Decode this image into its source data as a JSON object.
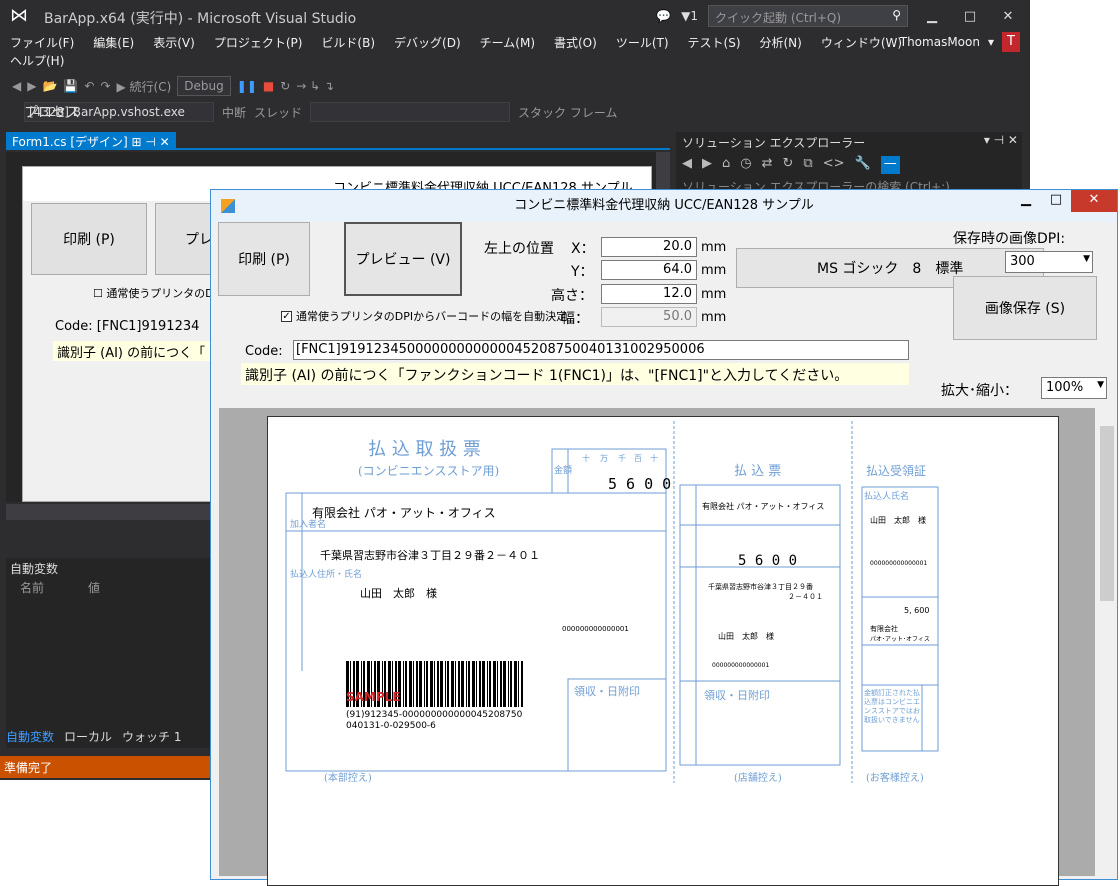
{
  "vs": {
    "title": "BarApp.x64 (実行中) - Microsoft Visual Studio",
    "notif": "▼1",
    "quick_launch": "クイック起動 (Ctrl+Q)",
    "menu": [
      "ファイル(F)",
      "編集(E)",
      "表示(V)",
      "プロジェクト(P)",
      "ビルド(B)",
      "デバッグ(D)",
      "チーム(M)",
      "書式(O)",
      "ツール(T)",
      "テスト(S)",
      "分析(N)",
      "ウィンドウ(W)"
    ],
    "menu2": "ヘルプ(H)",
    "user": "ThomasMoon",
    "user_initial": "T",
    "continue": "続行(C)",
    "config": "Debug",
    "process_label": "プロセス",
    "process": "[4328] BarApp.vshost.exe",
    "interrupt": "中断",
    "thread": "スレッド",
    "stack": "スタック フレーム",
    "doc_tab": "Form1.cs [デザイン]",
    "se_title": "ソリューション エクスプローラー",
    "se_search": "ソリューション エクスプローラーの検索 (Ctrl+;)",
    "locals_title": "自動変数",
    "col_name": "名前",
    "col_value": "値",
    "tabs": [
      "自動変数",
      "ローカル",
      "ウォッチ 1"
    ],
    "status": "準備完了"
  },
  "designer": {
    "title": "コンビニ標準料金代理収納 UCC/EAN128 サンプル",
    "print": "印刷 (P)",
    "preview": "プレビュ",
    "checkbox": "通常使うプリンタのDPI",
    "code": "Code: [FNC1]9191234",
    "hint": "識別子 (AI) の前につく「"
  },
  "app": {
    "title": "コンビニ標準料金代理収納 UCC/EAN128 サンプル",
    "print": "印刷 (P)",
    "preview": "プレビュー (V)",
    "pos_label": "左上の位置",
    "x_label": "X：",
    "x": "20.0",
    "y_label": "Y：",
    "y": "64.0",
    "h_label": "高さ：",
    "h": "12.0",
    "w_label": "幅：",
    "w": "50.0",
    "unit": "mm",
    "checkbox": "通常使うプリンタのDPIからバーコードの幅を自動決定",
    "font_btn": "MS ゴシック　8　標準",
    "dpi_label": "保存時の画像DPI:",
    "dpi": "300",
    "save_btn": "画像保存 (S)",
    "code_label": "Code:",
    "code": "[FNC1]91912345000000000000045208750040131002950006",
    "hint": "識別子 (AI) の前につく「ファンクションコード 1(FNC1)」は、\"[FNC1]\"と入力してください。",
    "zoom_label": "拡大･縮小：",
    "zoom": "100%"
  },
  "slip": {
    "main_title": "払 込 取 扱 票",
    "main_sub": "(コンビニエンスストア用)",
    "amount_label": "金額",
    "digits": [
      "十",
      "万",
      "千",
      "百",
      "十",
      "円"
    ],
    "amount": "5 6 0 0",
    "payee_label": "加入者名",
    "payee": "有限会社 パオ・アット・オフィス",
    "payer_label": "払込人住所・氏名",
    "address": "千葉県習志野市谷津３丁目２９番２－４０１",
    "payer_name": "山田　太郎　様",
    "ref_no": "000000000000001",
    "barcode_sample": "SAMPLE",
    "barcode_text1": "(91)912345-000000000000045208750",
    "barcode_text2": "040131-0-029500-6",
    "receipt_stamp": "領収・日附印",
    "main_foot": "(本部控え)",
    "mid_title": "払 込 票",
    "mid_payee": "有限会社 パオ・アット・オフィス",
    "mid_amount": "5 6 0 0",
    "mid_addr1": "千葉県習志野市谷津３丁目２９番",
    "mid_addr2": "２－４０１",
    "mid_name": "山田　太郎　様",
    "mid_ref": "000000000000001",
    "mid_stamp": "領収・日附印",
    "mid_foot": "(店舗控え)",
    "right_title": "払込受領証",
    "right_payer_label": "払込人氏名",
    "right_name": "山田　太郎　様",
    "right_ref": "000000000000001",
    "right_amount": "5, 600",
    "right_payee1": "有限会社",
    "right_payee2": "パオ･アット･オフィス",
    "right_note": "金額訂正された払込票はコンビニエンスストアではお取扱いできません",
    "right_foot": "(お客様控え)"
  }
}
